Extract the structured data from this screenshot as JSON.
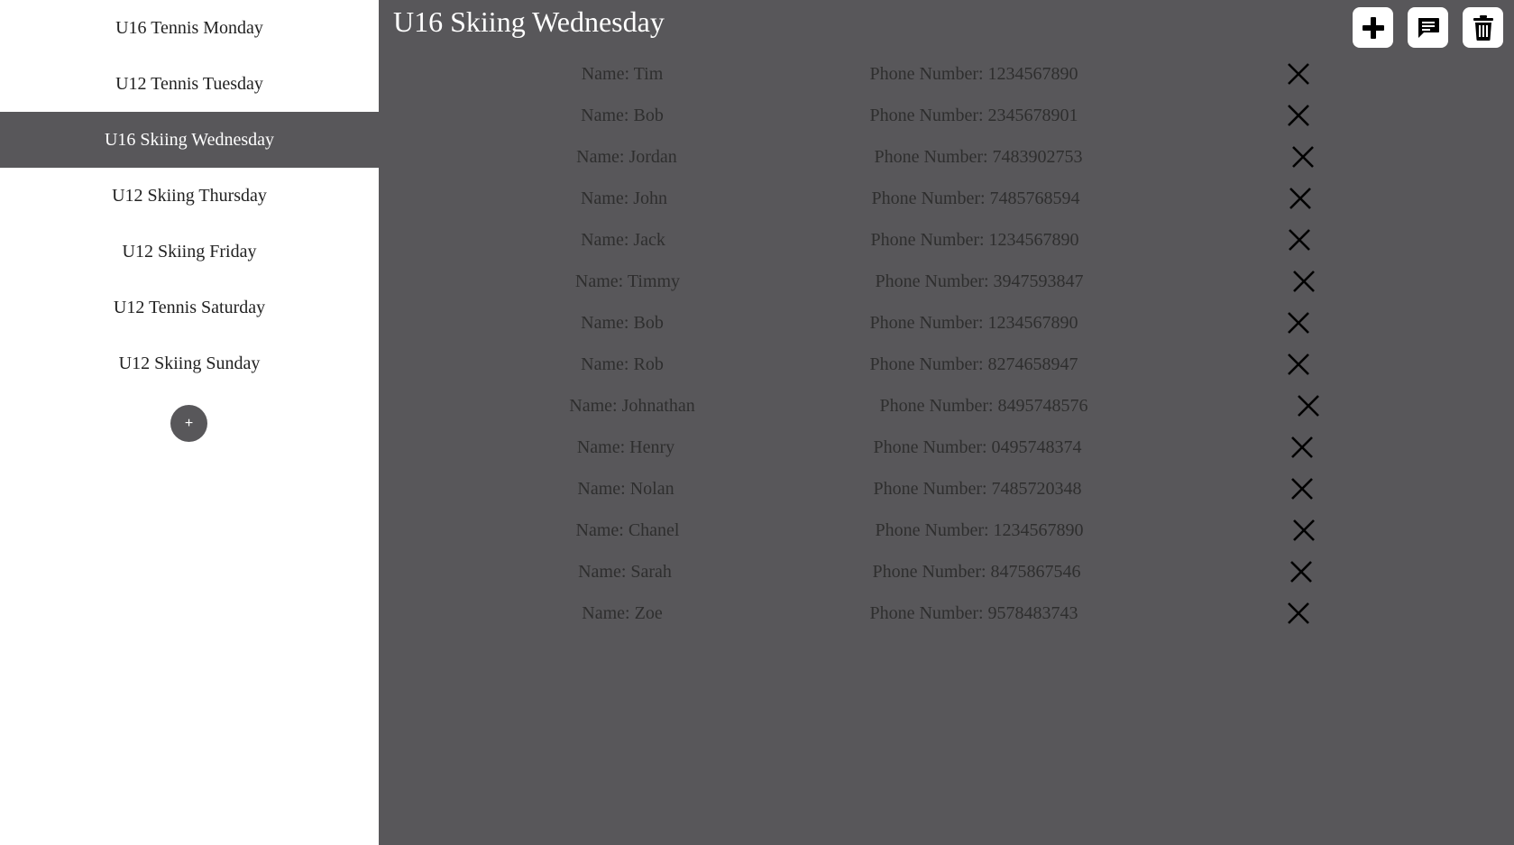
{
  "sidebar": {
    "items": [
      {
        "label": "U16 Tennis Monday"
      },
      {
        "label": "U12 Tennis Tuesday"
      },
      {
        "label": "U16 Skiing Wednesday"
      },
      {
        "label": "U12 Skiing Thursday"
      },
      {
        "label": "U12 Skiing Friday"
      },
      {
        "label": "U12 Tennis Saturday"
      },
      {
        "label": "U12 Skiing Sunday"
      }
    ],
    "active_index": 2,
    "add_button_label": "+"
  },
  "main": {
    "title": "U16 Skiing Wednesday",
    "toolbar": {
      "add_icon": "plus-icon",
      "message_icon": "message-icon",
      "delete_icon": "trash-icon"
    },
    "members": [
      {
        "name": "Name: Tim",
        "phone": "Phone Number: 1234567890"
      },
      {
        "name": "Name: Bob",
        "phone": "Phone Number: 2345678901"
      },
      {
        "name": "Name: Jordan",
        "phone": "Phone Number: 7483902753"
      },
      {
        "name": "Name: John",
        "phone": "Phone Number: 7485768594"
      },
      {
        "name": "Name: Jack",
        "phone": "Phone Number: 1234567890"
      },
      {
        "name": "Name: Timmy",
        "phone": "Phone Number: 3947593847"
      },
      {
        "name": "Name: Bob",
        "phone": "Phone Number: 1234567890"
      },
      {
        "name": "Name: Rob",
        "phone": "Phone Number: 8274658947"
      },
      {
        "name": "Name: Johnathan",
        "phone": "Phone Number: 8495748576"
      },
      {
        "name": "Name: Henry",
        "phone": "Phone Number: 0495748374"
      },
      {
        "name": "Name: Nolan",
        "phone": "Phone Number: 7485720348"
      },
      {
        "name": "Name: Chanel",
        "phone": "Phone Number: 1234567890"
      },
      {
        "name": "Name: Sarah",
        "phone": "Phone Number: 8475867546"
      },
      {
        "name": "Name: Zoe",
        "phone": "Phone Number: 9578483743"
      }
    ],
    "remove_icon": "close-icon"
  },
  "colors": {
    "panel_bg": "#58575a",
    "sidebar_bg": "#ffffff",
    "title_text": "#ffffff",
    "row_text": "#2e2e2e"
  }
}
